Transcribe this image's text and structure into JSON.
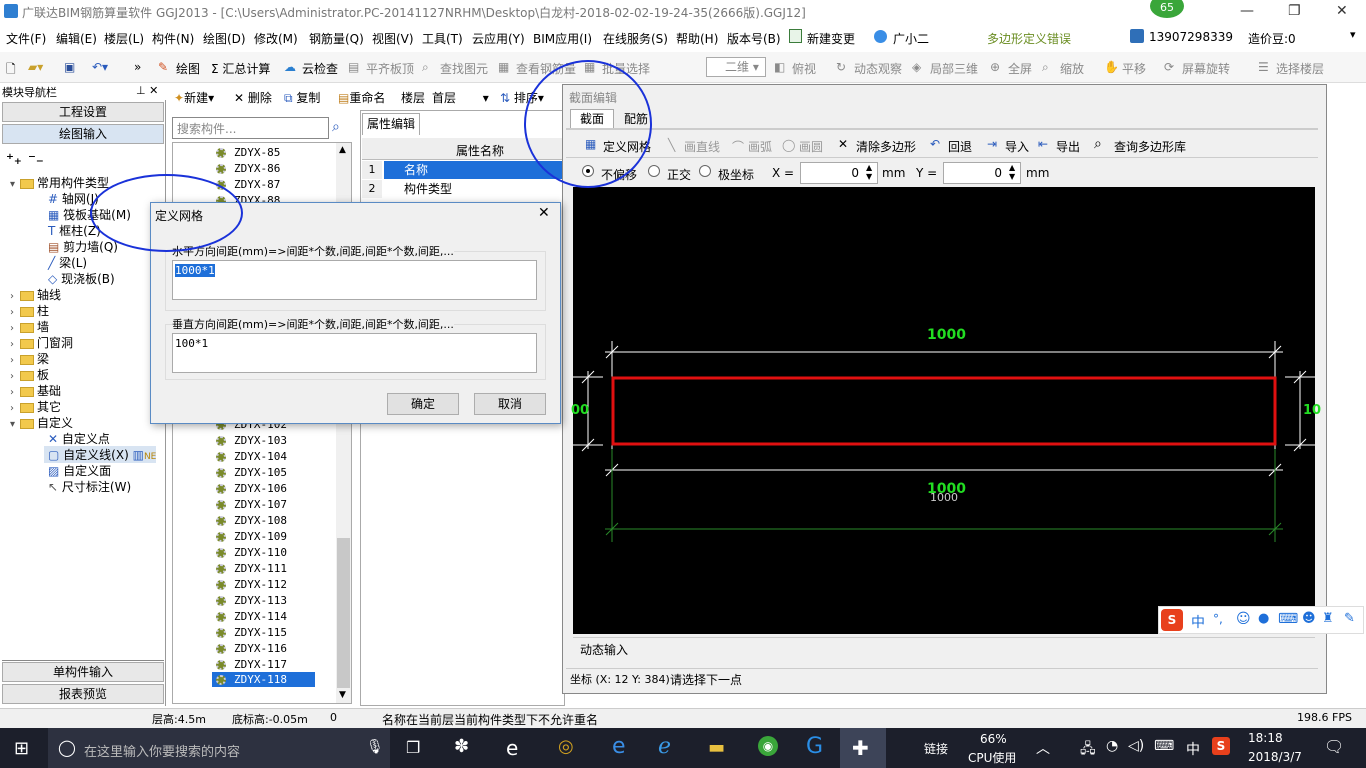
{
  "title_bar": {
    "title": "广联达BIM钢筋算量软件 GGJ2013 - [C:\\Users\\Administrator.PC-20141127NRHM\\Desktop\\白龙村-2018-02-02-19-24-35(2666版).GGJ12]",
    "badge": "65"
  },
  "menu": [
    "文件(F)",
    "编辑(E)",
    "楼层(L)",
    "构件(N)",
    "绘图(D)",
    "修改(M)",
    "钢筋量(Q)",
    "视图(V)",
    "工具(T)",
    "云应用(Y)",
    "BIM应用(I)",
    "在线服务(S)",
    "帮助(H)",
    "版本号(B)",
    "新建变更",
    "广小二"
  ],
  "menu_right": {
    "warning": "多边形定义错误",
    "phone": "13907298339",
    "cost": "造价豆:0"
  },
  "toolbar": [
    "绘图",
    "Σ 汇总计算",
    "云检查",
    "平齐板顶",
    "查找图元",
    "查看钢筋量",
    "批量选择",
    "二维",
    "俯视",
    "动态观察",
    "局部三维",
    "全屏",
    "缩放",
    "平移",
    "屏幕旋转",
    "选择楼层"
  ],
  "left_panel": {
    "header": "模块导航栏",
    "buttons": [
      "工程设置",
      "绘图输入"
    ],
    "bottom_buttons": [
      "单构件输入",
      "报表预览"
    ],
    "tree": {
      "root": "常用构件类型",
      "root_items": [
        "轴网(J)",
        "筏板基础(M)",
        "框柱(Z)",
        "剪力墙(Q)",
        "梁(L)",
        "现浇板(B)"
      ],
      "folders": [
        "轴线",
        "柱",
        "墙",
        "门窗洞",
        "梁",
        "板",
        "基础",
        "其它",
        "自定义"
      ],
      "custom_items": [
        "自定义点",
        "自定义线(X)",
        "自定义面",
        "尺寸标注(W)"
      ]
    }
  },
  "mid_panel": {
    "toolbar": [
      "新建",
      "删除",
      "复制",
      "重命名",
      "楼层",
      "首层",
      "排序"
    ],
    "search_placeholder": "搜索构件...",
    "items_top": [
      "ZDYX-85",
      "ZDYX-86",
      "ZDYX-87",
      "ZDYX-88"
    ],
    "items_bottom": [
      "ZDYX-102",
      "ZDYX-103",
      "ZDYX-104",
      "ZDYX-105",
      "ZDYX-106",
      "ZDYX-107",
      "ZDYX-108",
      "ZDYX-109",
      "ZDYX-110",
      "ZDYX-111",
      "ZDYX-112",
      "ZDYX-113",
      "ZDYX-114",
      "ZDYX-115",
      "ZDYX-116",
      "ZDYX-117",
      "ZDYX-118"
    ]
  },
  "prop_panel": {
    "tab": "属性编辑",
    "header": "属性名称",
    "rows": [
      {
        "num": "1",
        "name": "名称"
      },
      {
        "num": "2",
        "name": "构件类型"
      }
    ]
  },
  "section_editor": {
    "title": "截面编辑",
    "tabs": [
      "截面",
      "配筋"
    ],
    "toolbar": [
      "定义网格",
      "画直线",
      "画弧",
      "画圆",
      "清除多边形",
      "回退",
      "导入",
      "导出",
      "查询多边形库"
    ],
    "offset_options": [
      "不偏移",
      "正交",
      "极坐标"
    ],
    "x_label": "X =",
    "x_value": "0",
    "y_label": "Y =",
    "y_value": "0",
    "unit": "mm",
    "dim_top": "1000",
    "dim_bottom": "1000",
    "dim_bottom2": "1000",
    "dim_left": "00",
    "dim_right": "10",
    "dynamic_input": "动态输入",
    "coords": "坐标 (X: 12 Y: 384)",
    "prompt": "请选择下一点"
  },
  "dialog": {
    "title": "定义网格",
    "h_label": "水平方向间距(mm)=>间距*个数,间距,间距*个数,间距,...",
    "h_value": "1000*1",
    "v_label": "垂直方向间距(mm)=>间距*个数,间距,间距*个数,间距,...",
    "v_value": "100*1",
    "ok": "确定",
    "cancel": "取消"
  },
  "ime_bar": [
    "中",
    "°,",
    "☺",
    "🎤",
    "⌨"
  ],
  "status": {
    "floor_height": "层高:4.5m",
    "base_height": "底标高:-0.05m",
    "zero": "0",
    "message": "名称在当前层当前构件类型下不允许重名",
    "fps": "198.6 FPS"
  },
  "taskbar": {
    "search": "在这里输入你要搜索的内容",
    "link": "链接",
    "cpu_pct": "66%",
    "cpu_label": "CPU使用",
    "lang": "中",
    "time": "18:18",
    "date": "2018/3/7"
  }
}
